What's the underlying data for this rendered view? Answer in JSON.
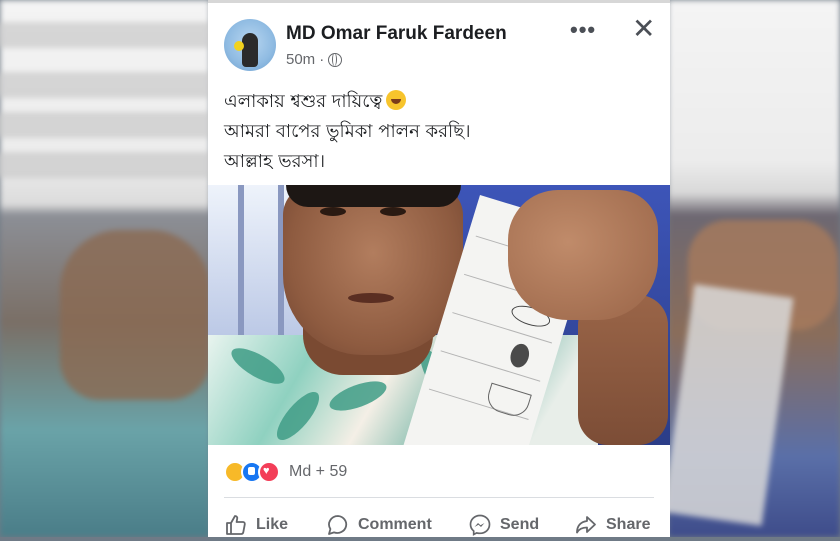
{
  "post": {
    "author": "MD Omar Faruk Fardeen",
    "time": "50m",
    "time_separator": "·",
    "lines": [
      "এলাকায় শ্বশুর দায়িত্বে",
      "আমরা বাপের ভুমিকা পালন করছি।",
      "আল্লাহ ভরসা।"
    ]
  },
  "header": {
    "more_label": "•••",
    "close_label": "✕"
  },
  "reactions": {
    "summary": "Md + 59"
  },
  "actions": {
    "like": "Like",
    "comment": "Comment",
    "send": "Send",
    "share": "Share"
  },
  "colors": {
    "text_primary": "#1c1e21",
    "text_secondary": "#65676b",
    "like_blue": "#1877f2",
    "love_red": "#f33e58",
    "care_yellow": "#f7b928"
  }
}
